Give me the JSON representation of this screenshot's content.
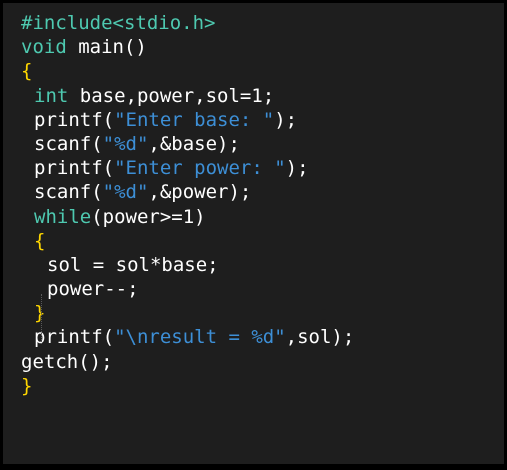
{
  "colors": {
    "background": "#1e1e1e",
    "text": "#ffffff",
    "keyword": "#4ec9b0",
    "string": "#3d8fd6",
    "brace": "#ffd700"
  },
  "code": {
    "lines": [
      {
        "indent": 0,
        "segments": [
          {
            "t": "#include<stdio.h>",
            "c": "k-green"
          }
        ]
      },
      {
        "indent": 0,
        "segments": [
          {
            "t": "void",
            "c": "k-kw"
          },
          {
            "t": " main()",
            "c": "k-plain"
          }
        ]
      },
      {
        "indent": 0,
        "segments": [
          {
            "t": "{",
            "c": "brace-yellow"
          }
        ]
      },
      {
        "indent": 2,
        "segments": [
          {
            "t": "int",
            "c": "k-kw"
          },
          {
            "t": " base,power,sol=1;",
            "c": "k-plain"
          }
        ]
      },
      {
        "indent": 2,
        "segments": [
          {
            "t": "printf(",
            "c": "k-plain"
          },
          {
            "t": "\"Enter base: \"",
            "c": "k-str"
          },
          {
            "t": ");",
            "c": "k-plain"
          }
        ]
      },
      {
        "indent": 2,
        "segments": [
          {
            "t": "scanf(",
            "c": "k-plain"
          },
          {
            "t": "\"%d\"",
            "c": "k-str"
          },
          {
            "t": ",&base);",
            "c": "k-plain"
          }
        ]
      },
      {
        "indent": 2,
        "segments": [
          {
            "t": "printf(",
            "c": "k-plain"
          },
          {
            "t": "\"Enter power: \"",
            "c": "k-str"
          },
          {
            "t": ");",
            "c": "k-plain"
          }
        ]
      },
      {
        "indent": 2,
        "segments": [
          {
            "t": "scanf(",
            "c": "k-plain"
          },
          {
            "t": "\"%d\"",
            "c": "k-str"
          },
          {
            "t": ",&power);",
            "c": "k-plain"
          }
        ]
      },
      {
        "indent": 2,
        "segments": [
          {
            "t": "while",
            "c": "k-kw"
          },
          {
            "t": "(power>=1)",
            "c": "k-plain"
          }
        ]
      },
      {
        "indent": 2,
        "segments": [
          {
            "t": "{",
            "c": "brace-yellow"
          }
        ]
      },
      {
        "indent": 3,
        "segments": [
          {
            "t": "sol = sol*base;",
            "c": "k-plain"
          }
        ]
      },
      {
        "indent": 3,
        "segments": [
          {
            "t": "power--;",
            "c": "k-plain"
          }
        ]
      },
      {
        "indent": 2,
        "segments": [
          {
            "t": "}",
            "c": "brace-yellow"
          }
        ]
      },
      {
        "indent": 2,
        "segments": [
          {
            "t": "printf(",
            "c": "k-plain"
          },
          {
            "t": "\"\\nresult = %d\"",
            "c": "k-str"
          },
          {
            "t": ",sol);",
            "c": "k-plain"
          }
        ]
      },
      {
        "indent": 1,
        "segments": [
          {
            "t": "getch();",
            "c": "k-plain"
          }
        ]
      },
      {
        "indent": 0,
        "segments": [
          {
            "t": "}",
            "c": "brace-yellow"
          }
        ]
      }
    ]
  }
}
